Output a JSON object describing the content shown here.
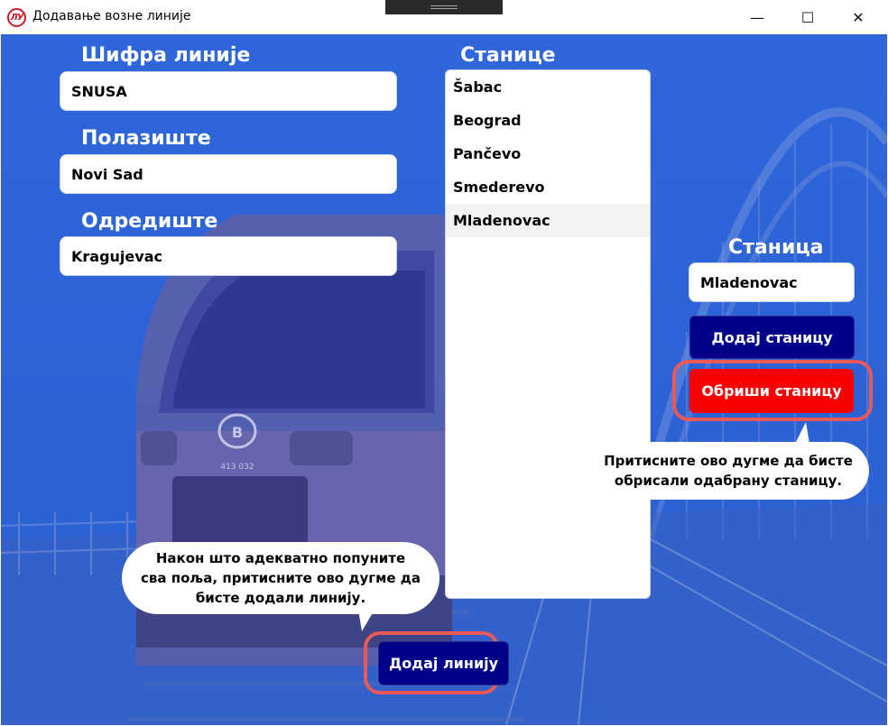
{
  "window": {
    "title": "Додавање возне линије",
    "logo_text": "ЛУ",
    "minimize_glyph": "—",
    "maximize_glyph": "☐",
    "close_glyph": "✕"
  },
  "form": {
    "code_label": "Шифра линије",
    "code_value": "SNUSA",
    "departure_label": "Полазиште",
    "departure_value": "Novi Sad",
    "destination_label": "Одредиште",
    "destination_value": "Kragujevac"
  },
  "stations": {
    "label": "Станице",
    "items": [
      "Šabac",
      "Beograd",
      "Pančevo",
      "Smederevo",
      "Mladenovac"
    ],
    "selected_index": 4
  },
  "station_editor": {
    "label": "Станица",
    "value": "Mladenovac",
    "add_label": "Додај станицу",
    "delete_label": "Обриши станицу"
  },
  "tooltips": {
    "delete_hint_line1": "Притисните ово дугме да бисте",
    "delete_hint_line2": "обрисали одабрану станицу.",
    "add_line_hint_line1": "Након што адекватно попуните",
    "add_line_hint_line2": "сва поља, притисните ово дугме да",
    "add_line_hint_line3": "бисте додали линију."
  },
  "footer": {
    "add_line_label": "Додај линију"
  },
  "train_number": "413 032",
  "colors": {
    "background_blue": "#2b63d6",
    "navy_button": "#03008a",
    "red_button": "#fa0000",
    "highlight_ring": "#ea5858"
  }
}
